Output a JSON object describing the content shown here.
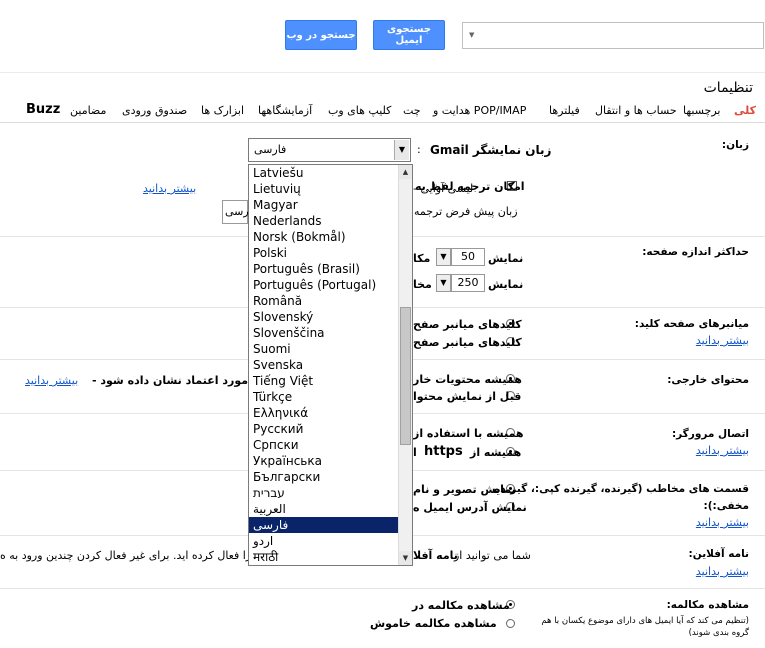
{
  "header": {
    "search_placeholder": "",
    "search_mail_button": "جستجوی ایمیل",
    "search_web_button": "جستجو در وب"
  },
  "page_title": "تنظیمات",
  "tabs": [
    {
      "label": "کلی",
      "active": true
    },
    {
      "label": "برچسبها"
    },
    {
      "label": "حساب ها و انتقال"
    },
    {
      "label": "فیلترها"
    },
    {
      "label": "هدایت و POP/IMAP"
    },
    {
      "label": "چت"
    },
    {
      "label": "کلیپ های وب"
    },
    {
      "label": "آزمایشگاهها"
    },
    {
      "label": "ابزارک ها"
    },
    {
      "label": "صندوق ورودی"
    },
    {
      "label": "مضامین"
    },
    {
      "label": "Buzz"
    }
  ],
  "language": {
    "label": "زبان:",
    "display_label": "زبان نمایشگر Gmail",
    "colon": ":",
    "selected": "فارسی",
    "translate_checkbox_label": "امکان ترجمه لفظ به",
    "translate_text": "لیسی آوایی -",
    "learn_more": "بیشتر بدانید",
    "default_translation_label": "زبان پیش فرض ترجمه",
    "translation_value": "رسی"
  },
  "language_options": [
    "Latviešu",
    "Lietuvių",
    "Magyar",
    "Nederlands",
    "Norsk (Bokmål)",
    "Polski",
    "Português (Brasil)",
    "Português (Portugal)",
    "Română",
    "Slovenský",
    "Slovenščina",
    "Suomi",
    "Svenska",
    "Tiếng Việt",
    "Türkçe",
    "Ελληνικά",
    "Русский",
    "Српски",
    "Українська",
    "Български",
    "עברית",
    "العربية",
    "فارسی",
    "اردو",
    "मराठी"
  ],
  "page_size": {
    "label": "حداکثر اندازه صفحه:",
    "show": "نمایش",
    "conv_value": "50",
    "conv_suffix": "مکا",
    "contact_value": "250",
    "contact_suffix": "مخا"
  },
  "shortcuts": {
    "label": "میانبرهای صفحه کلید:",
    "learn_more": "بیشتر بدانید",
    "option_on": "کلیدهای میانبر صفح",
    "option_off": "کلیدهای میانبر صفح"
  },
  "external_content": {
    "label": "محتوای خارجی:",
    "option_always": "همیشه محتویات خار",
    "trusted_text": "فرستندگان مورد اعتماد نشان داده شود -",
    "learn_more": "بیشتر بدانید",
    "option_ask": "قبل از نمایش محتوا"
  },
  "browser_connection": {
    "label": "اتصال مرورگر:",
    "learn_more": "بیشتر بدانید",
    "option_always": "همیشه با استفاده از",
    "option_https_prefix": "همیشه از",
    "option_https": "https",
    "option_https_suffix": "ا"
  },
  "contact_pictures": {
    "label_line1": "قسمت های مخاطب (گیرنده، گیرنده کپی:، گیرنده",
    "label_line2": "مخفی:):",
    "learn_more": "بیشتر بدانید",
    "option_show_pic": "نمایش تصویر و نام",
    "option_show_addr": "نمایش آدرس ایمیل ه"
  },
  "vacation": {
    "label": "نامه آفلاین:",
    "learn_more": "بیشتر بدانید",
    "text_part1": "شما می توانید از",
    "text_bold": "نامه آفلا",
    "text_part2": "ستم را فعال کرده اید. برای غیر فعال کردن چندین ورود به ه"
  },
  "conversation_view": {
    "label": "مشاهده مکالمه:",
    "sub_label": "(تنظیم می کند که آیا ایمیل های دارای موضوع یکسان با هم گروه بندی شوند)",
    "option_on": "مشاهده مکالمه در",
    "option_off": "مشاهده مکالمه خاموش"
  }
}
